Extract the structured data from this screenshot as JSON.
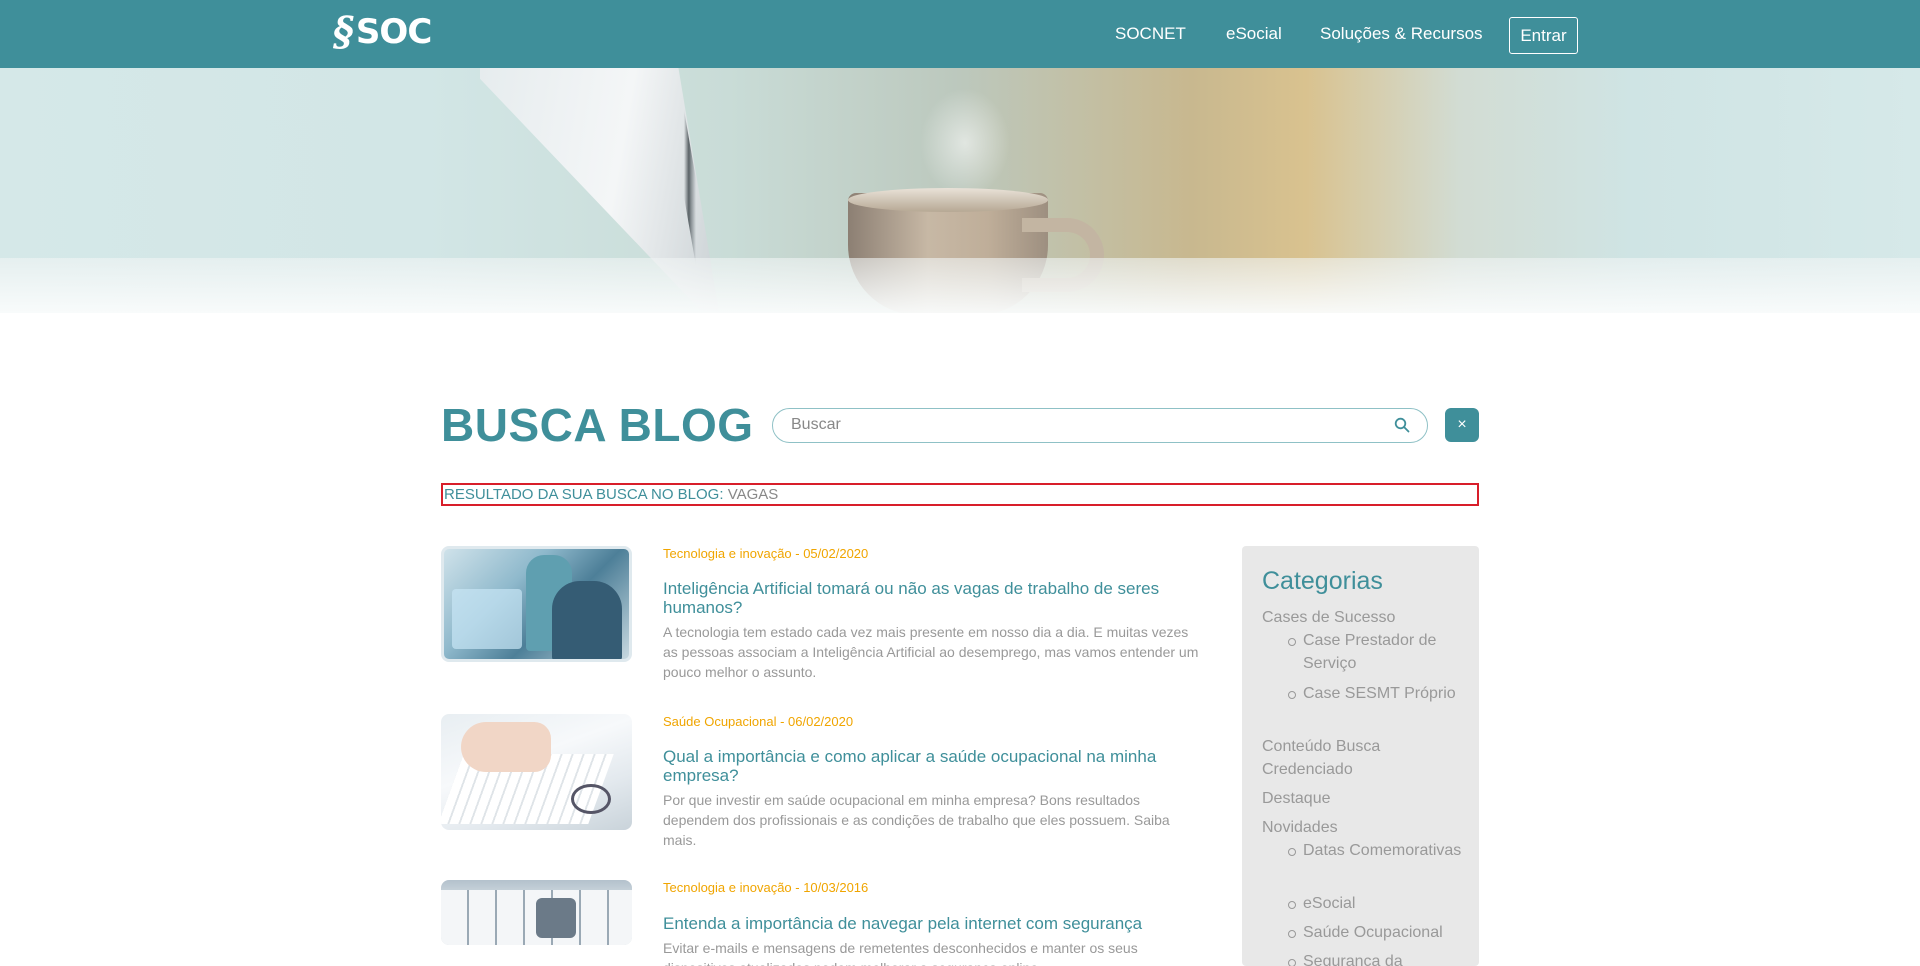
{
  "header": {
    "logo_text": "SOC",
    "nav": [
      "SOCNET",
      "eSocial",
      "Soluções & Recursos"
    ],
    "login_label": "Entrar"
  },
  "search": {
    "title": "BUSCA BLOG",
    "placeholder": "Buscar",
    "clear_label": "×",
    "result_label": "RESULTADO DA SUA BUSCA NO BLOG:",
    "result_term": "VAGAS"
  },
  "posts": [
    {
      "meta": "Tecnologia e inovação - 05/02/2020",
      "title": "Inteligência Artificial tomará ou não as vagas de trabalho de seres humanos?",
      "excerpt": "A tecnologia tem estado cada vez mais presente em nosso dia a dia. E muitas vezes as pessoas associam a Inteligência Artificial ao desemprego, mas vamos entender um pouco melhor o assunto."
    },
    {
      "meta": "Saúde Ocupacional - 06/02/2020",
      "title": "Qual a importância e como aplicar a saúde ocupacional na minha empresa?",
      "excerpt": "Por que investir em saúde ocupacional em minha empresa? Bons resultados dependem dos profissionais e as condições de trabalho que eles possuem. Saiba mais."
    },
    {
      "meta": "Tecnologia e inovação - 10/03/2016",
      "title": "Entenda a importância de navegar pela internet com segurança",
      "excerpt": "Evitar e-mails e mensagens de remetentes desconhecidos e manter os seus dispositivos atualizados podem melhorar a segurança online"
    }
  ],
  "sidebar": {
    "title": "Categorias",
    "cases": "Cases de Sucesso",
    "case_prestador": "Case Prestador de Serviço",
    "case_sesmt": "Case SESMT Próprio",
    "conteudo": "Conteúdo Busca Credenciado",
    "destaque": "Destaque",
    "novidades": "Novidades",
    "datas": "Datas Comemorativas",
    "esocial": "eSocial",
    "saude": "Saúde Ocupacional",
    "seguranca": "Segurança da"
  },
  "colors": {
    "brand": "#3f8f9a",
    "meta_accent": "#f0a500",
    "highlight_border": "#d81e2a"
  }
}
